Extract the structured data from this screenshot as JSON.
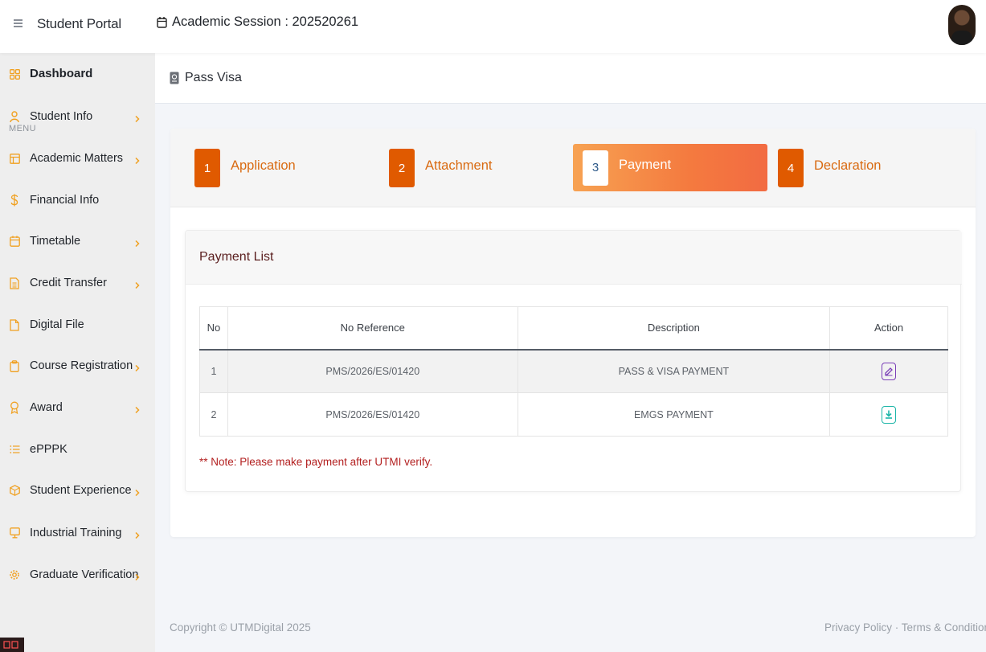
{
  "header": {
    "brand": "Student Portal",
    "session_label": "Academic Session : 202520261"
  },
  "sidebar": {
    "dashboard": "Dashboard",
    "menu_caption": "MENU",
    "items": [
      {
        "label": "Student Info",
        "icon": "user-icon",
        "has_children": true
      },
      {
        "label": "Academic Matters",
        "icon": "layout-icon",
        "has_children": true
      },
      {
        "label": "Financial Info",
        "icon": "dollar-icon",
        "has_children": false
      },
      {
        "label": "Timetable",
        "icon": "calendar-icon",
        "has_children": true
      },
      {
        "label": "Credit Transfer",
        "icon": "document-icon",
        "has_children": true
      },
      {
        "label": "Digital File",
        "icon": "file-icon",
        "has_children": false
      },
      {
        "label": "Course Registration",
        "icon": "clipboard-icon",
        "has_children": true
      },
      {
        "label": "Award",
        "icon": "award-icon",
        "has_children": true
      },
      {
        "label": "ePPPK",
        "icon": "list-icon",
        "has_children": false
      },
      {
        "label": "Student Experience",
        "icon": "package-icon",
        "has_children": true
      },
      {
        "label": "Industrial Training",
        "icon": "monitor-icon",
        "has_children": true
      },
      {
        "label": "Graduate Verification",
        "icon": "gear-icon",
        "has_children": true
      }
    ]
  },
  "breadcrumb": {
    "page": "Pass Visa"
  },
  "wizard": {
    "steps": [
      {
        "num": "1",
        "label": "Application"
      },
      {
        "num": "2",
        "label": "Attachment"
      },
      {
        "num": "3",
        "label": "Payment"
      },
      {
        "num": "4",
        "label": "Declaration"
      }
    ],
    "active_step": "3"
  },
  "payment": {
    "title": "Payment List",
    "columns": [
      "No",
      "No Reference",
      "Description",
      "Action"
    ],
    "rows": [
      {
        "no": "1",
        "ref": "PMS/2026/ES/01420",
        "desc": "PASS & VISA PAYMENT",
        "action": "edit-icon"
      },
      {
        "no": "2",
        "ref": "PMS/2026/ES/01420",
        "desc": "EMGS PAYMENT",
        "action": "download-icon"
      }
    ],
    "note": "** Note: Please make payment after UTMI verify."
  },
  "footer": {
    "copyright": "Copyright © UTMDigital 2025",
    "links": "Privacy Policy · Terms & Conditions"
  },
  "colors": {
    "accent": "#e05a00",
    "active_gradient_start": "#f7a252",
    "active_gradient_end": "#f26b42",
    "note": "#b32020",
    "sidebar_icon": "#f0a020"
  }
}
